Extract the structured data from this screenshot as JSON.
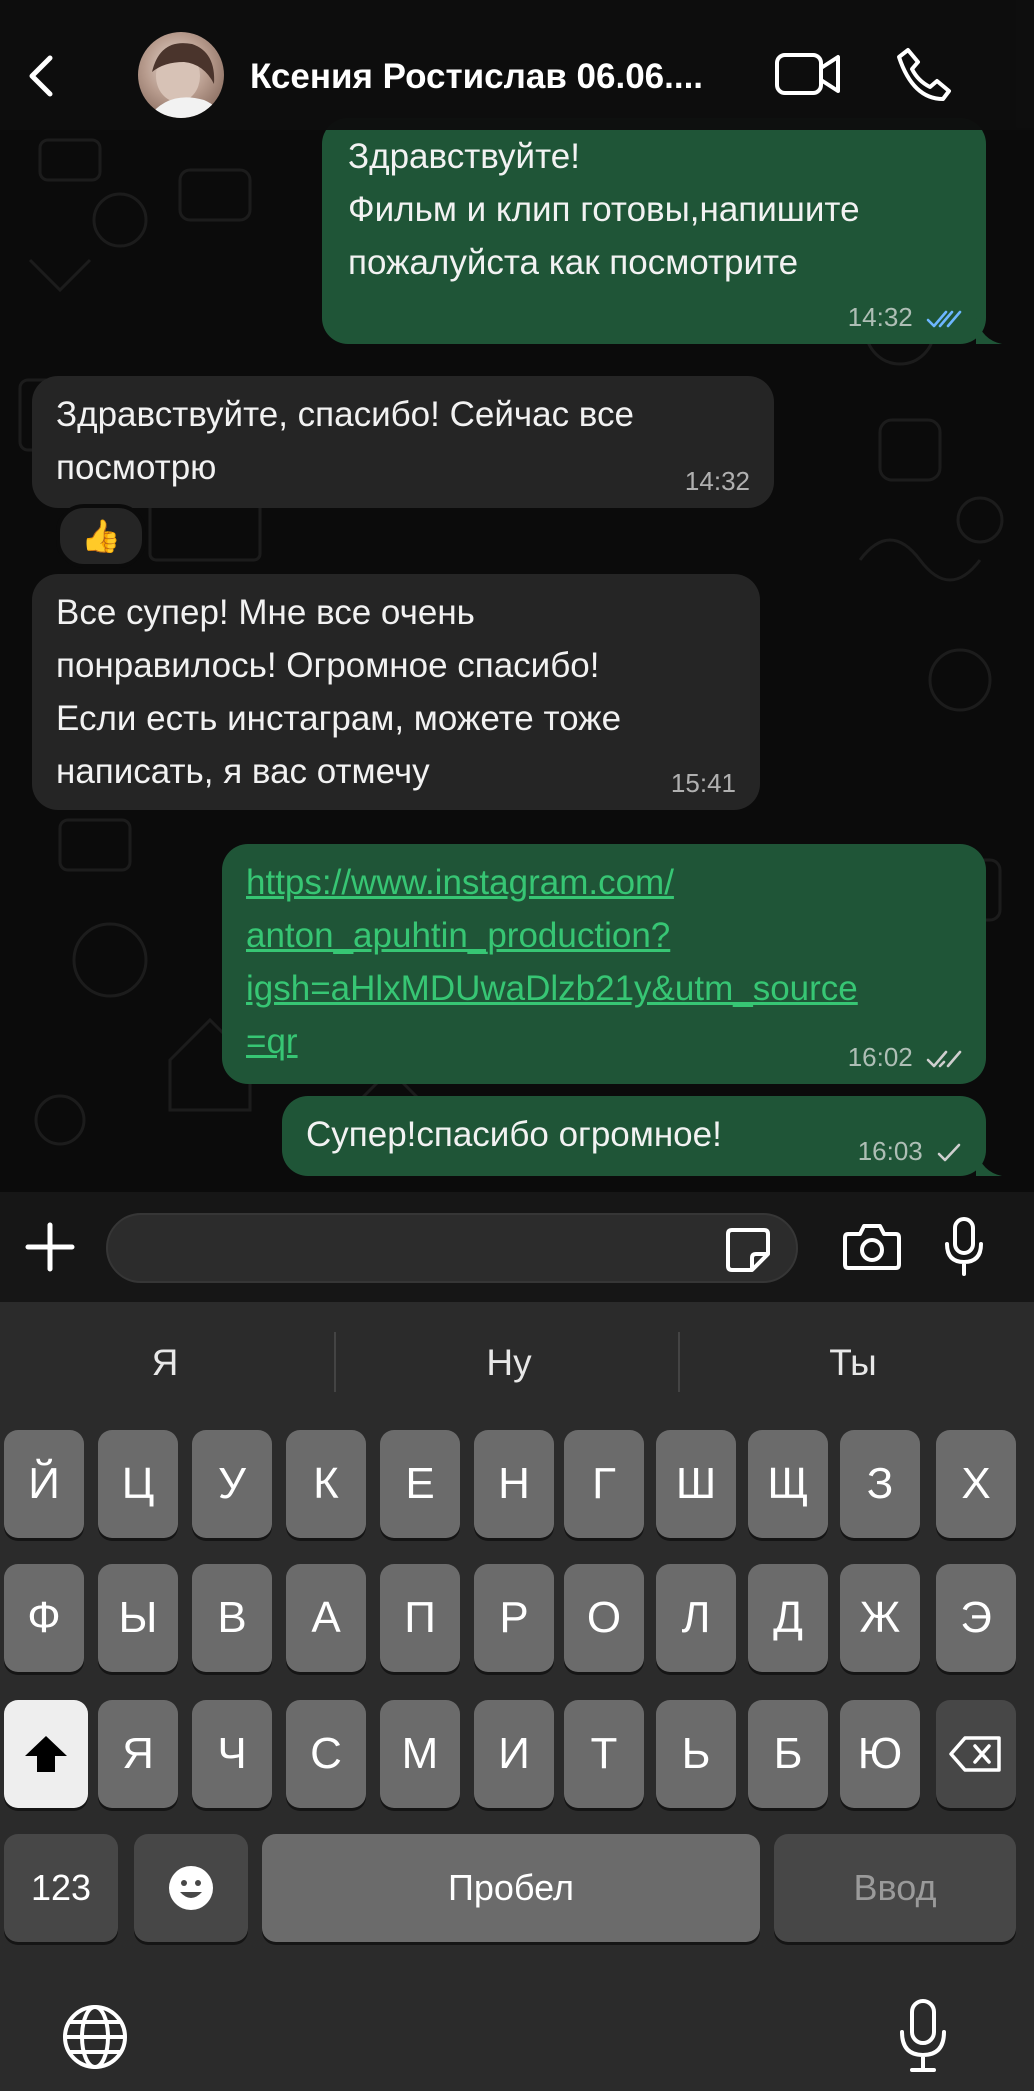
{
  "header": {
    "contact_name": "Ксения Ростислав 06.06...."
  },
  "messages": [
    {
      "direction": "out",
      "text": "Здравствуйте!\nФильм и клип готовы,напишите\nпожалуйста как посмотрите",
      "time": "14:32",
      "status": "read"
    },
    {
      "direction": "in",
      "text": "Здравствуйте, спасибо! Сейчас все\nпосмотрю",
      "time": "14:32",
      "reaction": "👍"
    },
    {
      "direction": "in",
      "text": "Все супер! Мне все очень\nпонравилось! Огромное спасибо!\nЕсли есть инстаграм, можете тоже\nнаписать, я вас отмечу",
      "time": "15:41"
    },
    {
      "direction": "out",
      "text": "https://www.instagram.com/\nanton_apuhtin_production?\nigsh=aHlxMDUwaDlzb21y&utm_source\n=qr",
      "time": "16:02",
      "status": "delivered"
    },
    {
      "direction": "out",
      "text": "Супер!спасибо огромное!",
      "time": "16:03",
      "status": "sent"
    }
  ],
  "composer": {
    "placeholder": ""
  },
  "keyboard": {
    "suggestions": [
      "Я",
      "Ну",
      "Ты"
    ],
    "row1": [
      "Й",
      "Ц",
      "У",
      "К",
      "Е",
      "Н",
      "Г",
      "Ш",
      "Щ",
      "З",
      "Х"
    ],
    "row2": [
      "Ф",
      "Ы",
      "В",
      "А",
      "П",
      "Р",
      "О",
      "Л",
      "Д",
      "Ж",
      "Э"
    ],
    "row3": [
      "Я",
      "Ч",
      "С",
      "М",
      "И",
      "Т",
      "Ь",
      "Б",
      "Ю"
    ],
    "numbers_label": "123",
    "space_label": "Пробел",
    "enter_label": "Ввод"
  },
  "colors": {
    "outgoing_bubble": "#1f5537",
    "incoming_bubble": "#252525",
    "link": "#37c674",
    "read_ticks": "#6db6ff"
  }
}
